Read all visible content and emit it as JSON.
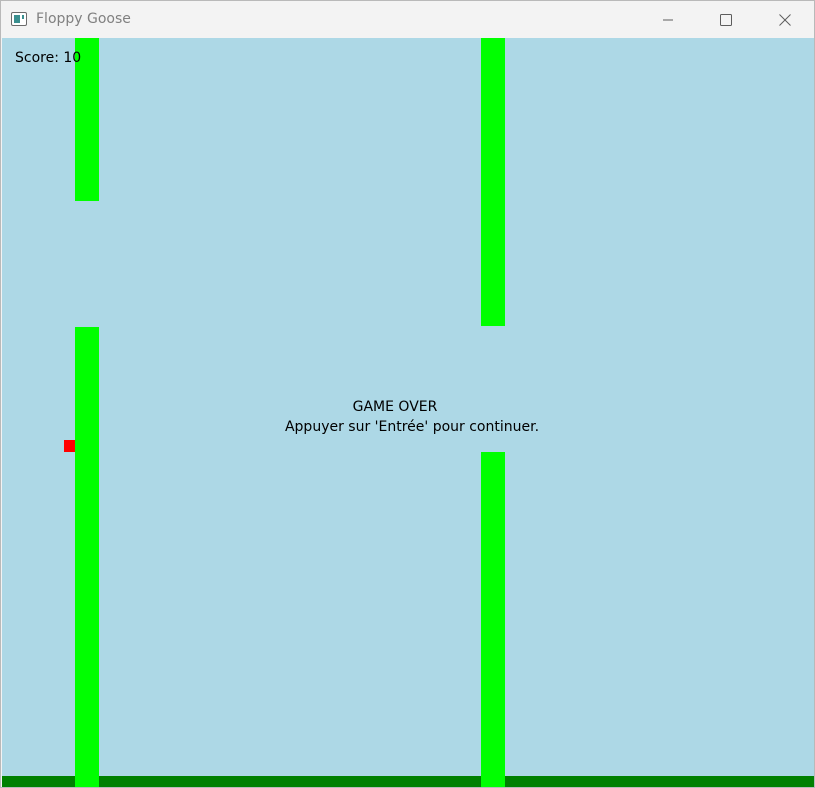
{
  "window": {
    "title": "Floppy Goose",
    "controls": {
      "minimize_icon": "minimize-icon",
      "maximize_icon": "maximize-icon",
      "close_icon": "close-icon"
    }
  },
  "game": {
    "score_label": "Score:",
    "score_value": "10",
    "game_over_title": "GAME OVER",
    "game_over_hint": "Appuyer sur 'Entrée' pour continuer.",
    "colors": {
      "sky": "#add8e6",
      "pipe": "#00ff00",
      "ground": "#008000",
      "player": "#ff0000"
    }
  }
}
